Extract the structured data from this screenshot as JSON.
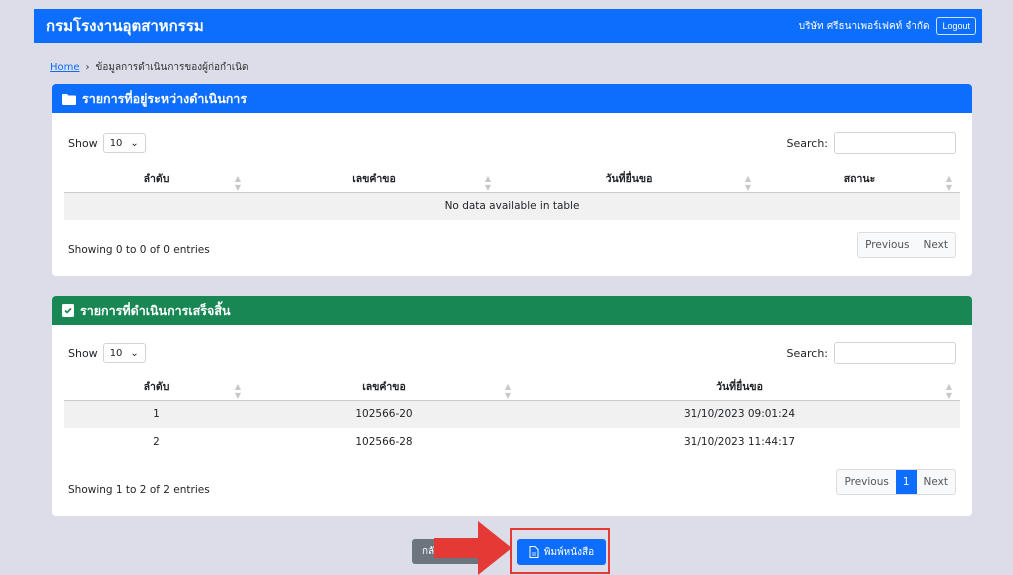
{
  "navbar": {
    "brand": "กรมโรงงานอุตสาหกรรม",
    "company": "บริษัท ศรีธนาเพอร์เฟคท์ จำกัด",
    "logout": "Logout"
  },
  "breadcrumb": {
    "home": "Home",
    "separator": "›",
    "current": "ข้อมูลการดำเนินการของผู้ก่อกำเนิด"
  },
  "in_progress": {
    "title": "รายการที่อยู่ระหว่างดำเนินการ",
    "show_label": "Show",
    "show_value": "10",
    "search_label": "Search:",
    "columns": [
      "ลำดับ",
      "เลขคำขอ",
      "วันที่ยื่นขอ",
      "สถานะ"
    ],
    "empty": "No data available in table",
    "info": "Showing 0 to 0 of 0 entries",
    "prev": "Previous",
    "next": "Next"
  },
  "completed": {
    "title": "รายการที่ดำเนินการเสร็จสิ้น",
    "show_label": "Show",
    "show_value": "10",
    "search_label": "Search:",
    "columns": [
      "ลำดับ",
      "เลขคำขอ",
      "วันที่ยื่นขอ"
    ],
    "rows": [
      {
        "no": "1",
        "req": "102566-20",
        "date": "31/10/2023 09:01:24"
      },
      {
        "no": "2",
        "req": "102566-28",
        "date": "31/10/2023 11:44:17"
      }
    ],
    "info": "Showing 1 to 2 of 2 entries",
    "prev": "Previous",
    "page": "1",
    "next": "Next"
  },
  "buttons": {
    "back": "กลับไ",
    "print": "พิมพ์หนังสือ"
  },
  "colors": {
    "primary": "#0d6efd",
    "success": "#198754",
    "secondary": "#6c757d",
    "highlight": "#e53935"
  }
}
